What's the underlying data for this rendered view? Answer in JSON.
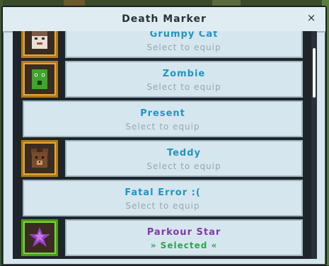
{
  "dialog": {
    "title": "Death Marker",
    "close_label": "×"
  },
  "items": [
    {
      "name": "Grumpy Cat",
      "status": "Select to equip",
      "icon": "grumpy-cat-icon",
      "selected": false
    },
    {
      "name": "Zombie",
      "status": "Select to equip",
      "icon": "zombie-icon",
      "selected": false
    },
    {
      "name": "Present",
      "status": "Select to equip",
      "icon": "",
      "selected": false
    },
    {
      "name": "Teddy",
      "status": "Select to equip",
      "icon": "teddy-icon",
      "selected": false
    },
    {
      "name": "Fatal Error :(",
      "status": "Select to equip",
      "icon": "",
      "selected": false
    },
    {
      "name": "Parkour Star",
      "status": "» Selected «",
      "icon": "parkour-star-icon",
      "selected": true
    }
  ],
  "colors": {
    "item_name": "#1d95c6",
    "selected_name": "#7d3aa8",
    "selected_status": "#2aa84a",
    "status_text": "#9aa6ad"
  }
}
